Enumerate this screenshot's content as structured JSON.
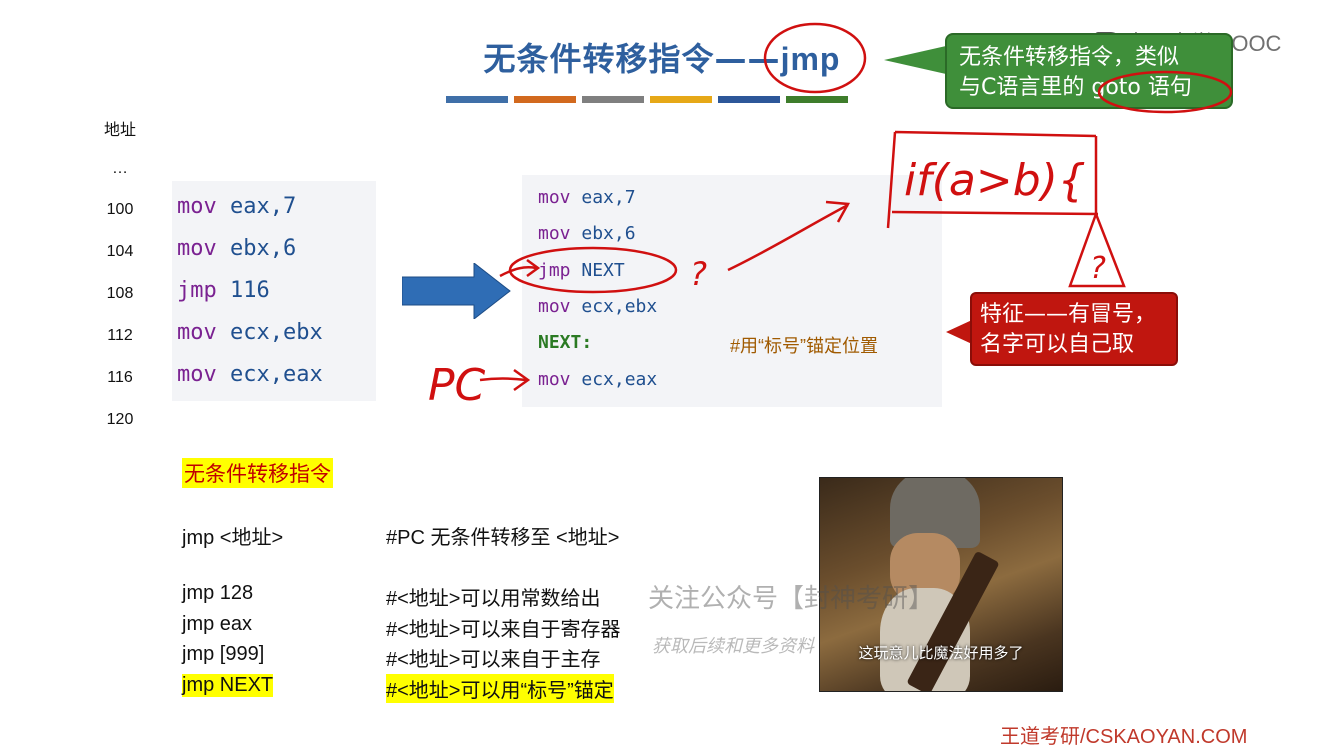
{
  "title": {
    "main": "无条件转移指令——",
    "jmp": "jmp"
  },
  "stripes": [
    "#3f6fa8",
    "#d2691e",
    "#7f7f7f",
    "#e6a817",
    "#2d5799",
    "#3e7d2b"
  ],
  "watermark_brand": "中国大学MOOC",
  "green_note": {
    "line1": "无条件转移指令，类似",
    "line2": "与C语言里的 goto 语句"
  },
  "addresses": {
    "header": "地址",
    "dots": "…",
    "values": [
      "100",
      "104",
      "108",
      "112",
      "116",
      "120"
    ]
  },
  "code_by_address": [
    {
      "op": "mov",
      "args": "eax,7"
    },
    {
      "op": "mov",
      "args": "ebx,6"
    },
    {
      "op": "jmp",
      "args": "116"
    },
    {
      "op": "mov",
      "args": "ecx,ebx"
    },
    {
      "op": "mov",
      "args": "ecx,eax"
    }
  ],
  "code_by_label": [
    {
      "op": "mov",
      "args": "eax,7"
    },
    {
      "op": "mov",
      "args": "ebx,6"
    },
    {
      "op": "jmp",
      "args": "NEXT"
    },
    {
      "op": "mov",
      "args": "ecx,ebx"
    },
    {
      "label": "NEXT:",
      "comment": "#用“标号”锚定位置"
    },
    {
      "op": "mov",
      "args": "ecx,eax"
    }
  ],
  "red_note": {
    "line1": "特征——有冒号，",
    "line2": "名字可以自己取"
  },
  "handwriting": {
    "if_cond": "if(a>b){",
    "question1": "?",
    "question2": "?",
    "pc": "PC"
  },
  "section_title": "无条件转移指令",
  "syntax": [
    {
      "code": "jmp <地址>",
      "comment": "#PC 无条件转移至 <地址>"
    },
    {
      "code": "jmp 128",
      "comment": "#<地址>可以用常数给出"
    },
    {
      "code": "jmp eax",
      "comment": "#<地址>可以来自于寄存器"
    },
    {
      "code": "jmp [999]",
      "comment": "#<地址>可以来自于主存"
    },
    {
      "code": "jmp NEXT",
      "comment": "#<地址>可以用“标号”锚定"
    }
  ],
  "overlay_watermark": {
    "line1": "关注公众号【封神考研】",
    "line2": "获取后续和更多资料"
  },
  "photo_subtitle": "这玩意儿比魔法好用多了",
  "footer": "王道考研/CSKAOYAN.COM"
}
